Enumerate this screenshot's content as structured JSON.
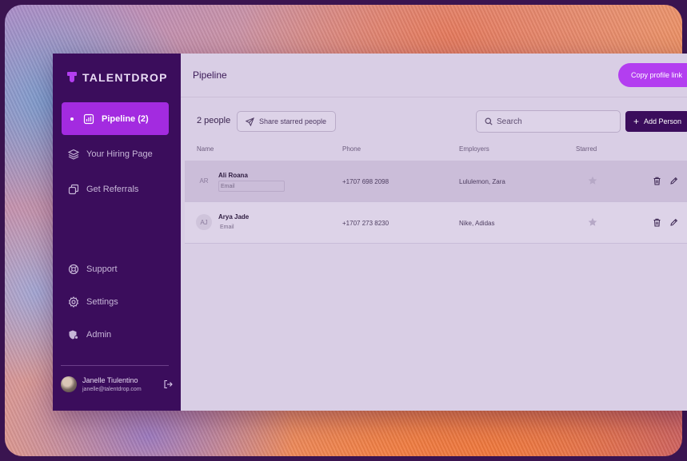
{
  "brand": {
    "name": "TALENTDROP"
  },
  "sidebar": {
    "items": [
      {
        "label": "Pipeline (2)",
        "icon": "chart-icon",
        "active": true
      },
      {
        "label": "Your Hiring Page",
        "icon": "layers-icon"
      },
      {
        "label": "Get Referrals",
        "icon": "copy-icon"
      }
    ],
    "bottom_items": [
      {
        "label": "Support",
        "icon": "lifebuoy-icon"
      },
      {
        "label": "Settings",
        "icon": "gear-icon"
      },
      {
        "label": "Admin",
        "icon": "admin-icon"
      }
    ],
    "user": {
      "name": "Janelle Tiulentino",
      "email": "janelle@talentdrop.com"
    }
  },
  "header": {
    "title": "Pipeline",
    "copy_label": "Copy profile link"
  },
  "toolbar": {
    "count": "2 people",
    "share_label": "Share starred people",
    "search_placeholder": "Search",
    "add_label": "Add Person"
  },
  "table": {
    "columns": [
      "Name",
      "Phone",
      "Employers",
      "Starred"
    ],
    "rows": [
      {
        "initials": "AR",
        "name": "Ali Roana",
        "email": "Email",
        "phone": "+1707 698 2098",
        "employers": "Lululemon, Zara",
        "starred": false
      },
      {
        "initials": "AJ",
        "name": "Arya Jade",
        "email": "Email",
        "phone": "+1707 273 8230",
        "employers": "Nike, Adidas",
        "starred": false
      }
    ]
  },
  "colors": {
    "sidebar": "#3b0d5c",
    "accent": "#a32be0",
    "button": "#b33ef0"
  }
}
